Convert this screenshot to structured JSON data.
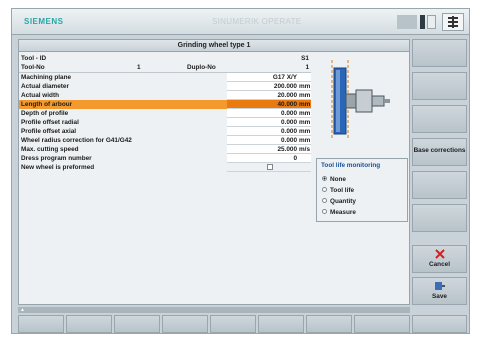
{
  "header": {
    "brand": "SIEMENS",
    "status": "SINUMERIK OPERATE",
    "icon": "system-icon"
  },
  "window": {
    "title": "Grinding wheel type 1"
  },
  "fields": {
    "tool_id_label": "Tool - ID",
    "tool_id_value": "S1",
    "tool_no_label": "Tool-No",
    "tool_no_value": "1",
    "duplo_label": "Duplo-No",
    "duplo_value": "1",
    "rows": [
      {
        "label": "Machining plane",
        "value": "G17 X/Y",
        "unit": ""
      },
      {
        "label": "Actual diameter",
        "value": "200.000",
        "unit": "mm"
      },
      {
        "label": "Actual width",
        "value": "20.000",
        "unit": "mm"
      },
      {
        "label": "Length of arbour",
        "value": "40.000",
        "unit": "mm"
      },
      {
        "label": "Depth of profile",
        "value": "0.000",
        "unit": "mm"
      },
      {
        "label": "Profile offset radial",
        "value": "0.000",
        "unit": "mm"
      },
      {
        "label": "Profile offset axial",
        "value": "0.000",
        "unit": "mm"
      },
      {
        "label": "Wheel radius correction for G41/G42",
        "value": "0.000",
        "unit": "mm"
      },
      {
        "label": "Max. cutting speed",
        "value": "25.000",
        "unit": "m/s"
      },
      {
        "label": "Dress program number",
        "value": "0",
        "unit": ""
      },
      {
        "label": "New wheel is preformed",
        "value": "",
        "unit": ""
      }
    ]
  },
  "monitoring": {
    "title": "Tool life monitoring",
    "options": [
      "None",
      "Tool life",
      "Quantity",
      "Measure"
    ],
    "selected": "None"
  },
  "softkeys_right": {
    "base_corrections": "Base corrections",
    "cancel": "Cancel",
    "save": "Save"
  },
  "colors": {
    "highlight": "#f49a2c",
    "brand": "#2aa5a5",
    "group_title": "#1a4f9c"
  }
}
